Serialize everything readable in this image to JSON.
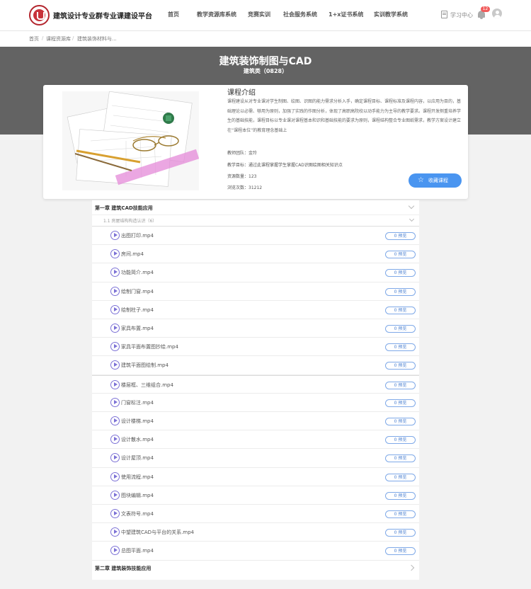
{
  "header": {
    "site_title": "建筑设计专业群专业课建设平台",
    "nav": [
      "首页",
      "教学资源库系统",
      "竞赛实训",
      "社会服务系统",
      "1+x证书系统",
      "实训教学系统"
    ],
    "study_center": "学习中心",
    "notification_count": "12"
  },
  "breadcrumb": [
    "首页",
    "课程资源库",
    "建筑装饰材料与..."
  ],
  "course": {
    "title": "建筑装饰制图与CAD",
    "subtitle": "建筑类（0828）"
  },
  "intro": {
    "heading": "课程介绍",
    "text": "课程建设从对专业课对学生制图、绘图、识图的能力需求分析入手，确定课程目标、课程标准及课程内容，以应用为目的，基础理论以必需、够用为原则，加强了实践的作图分析，体现了高职高院校以动手能力为主导的教学要求。课程开发侧重培养学生的基础技能，课程目标以专业课对课程基本和识和基础技能的要求为原则，课程结构整合专业图纸需求，教学方案设计建立在“课程本位”的教育理念基础上",
    "team": "教师团队：金玲",
    "goal": "教学目标：通过此课程掌握学生掌握CAD识图绘图相关知识点",
    "resources": "资源数量：123",
    "views": "浏览次数：31212",
    "favorite_label": "收藏课程"
  },
  "chapters": [
    {
      "title": "第一章  建筑CAD技能应用",
      "section": "1.1  房屋结构构造认识（6）",
      "items": [
        "出图打印.mp4",
        "房间.mp4",
        "功能简介.mp4",
        "绘制门窗.mp4",
        "绘制柱子.mp4",
        "家具布置.mp4",
        "家具平面布置图抄绘.mp4",
        "建筑平面图绘制.mp4",
        "楼层框、三维组合.mp4",
        "门窗标注.mp4",
        "设计楼梯.mp4",
        "设计散水.mp4",
        "设计屋顶.mp4",
        "使用流程.mp4",
        "图块编辑.mp4",
        "文表符号.mp4",
        "中望建筑CAD与平台的关系.mp4",
        "总图平面.mp4"
      ]
    },
    {
      "title": "第二章  建筑装饰技能应用"
    }
  ],
  "preview_label": "0 预览",
  "colors": {
    "accent": "#4a95f0",
    "banner": "#636363",
    "play_icon": "#7d72d6",
    "logo": "#c8323a",
    "badge": "#f15c5c"
  },
  "icons": [
    "logo-icon",
    "book-icon",
    "bell-icon",
    "avatar-icon",
    "star-icon",
    "play-icon",
    "chevron-down-icon",
    "chevron-right-icon"
  ]
}
